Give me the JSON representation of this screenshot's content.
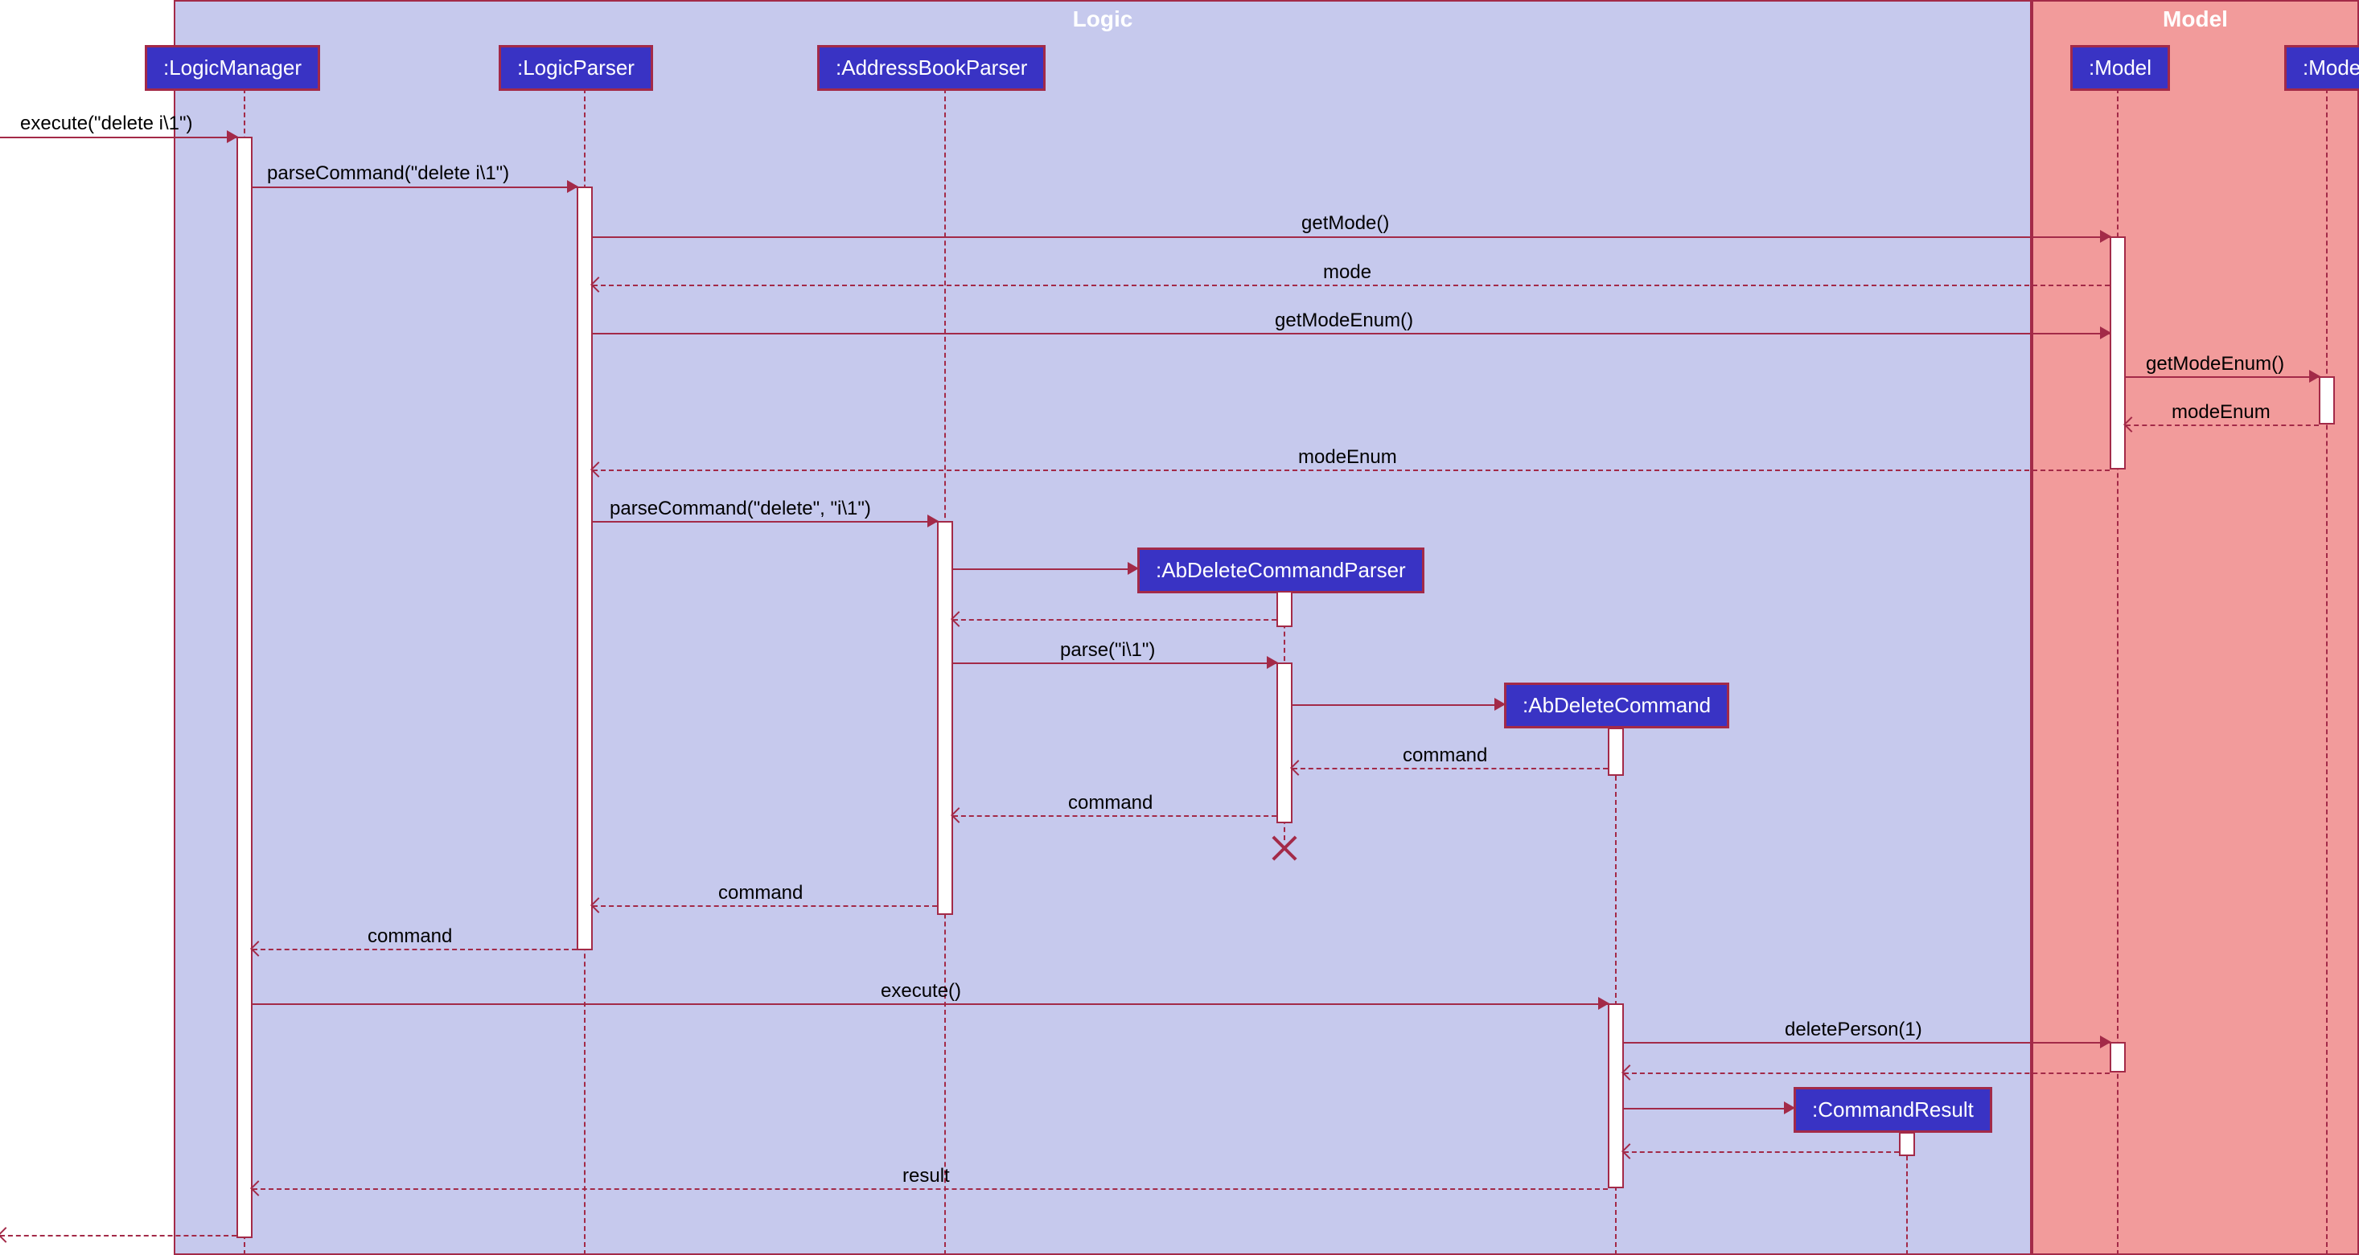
{
  "containers": {
    "logic": {
      "title": "Logic"
    },
    "model": {
      "title": "Model"
    }
  },
  "participants": {
    "logicManager": ":LogicManager",
    "logicParser": ":LogicParser",
    "addressBookParser": ":AddressBookParser",
    "abDeleteCommandParser": ":AbDeleteCommandParser",
    "abDeleteCommand": ":AbDeleteCommand",
    "commandResult": ":CommandResult",
    "model": ":Model",
    "mode": ":Mode"
  },
  "messages": {
    "execute1": "execute(\"delete i\\1\")",
    "parseCommand1": "parseCommand(\"delete i\\1\")",
    "getMode": "getMode()",
    "modeReturn": "mode",
    "getModeEnum1": "getModeEnum()",
    "getModeEnum2": "getModeEnum()",
    "modeEnumReturn1": "modeEnum",
    "modeEnumReturn2": "modeEnum",
    "parseCommand2": "parseCommand(\"delete\", \"i\\1\")",
    "parse": "parse(\"i\\1\")",
    "commandReturn1": "command",
    "commandReturn2": "command",
    "commandReturn3": "command",
    "commandReturn4": "command",
    "execute2": "execute()",
    "deletePerson": "deletePerson(1)",
    "result": "result"
  }
}
